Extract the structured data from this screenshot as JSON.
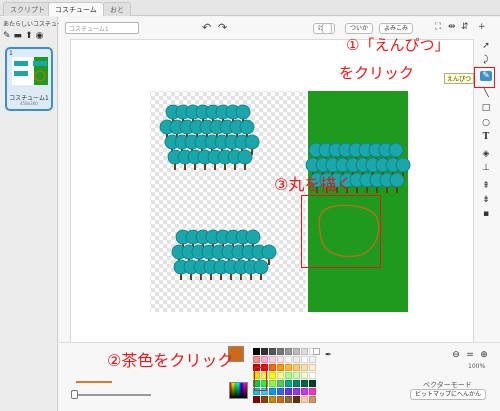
{
  "tabs": [
    {
      "label": "スクリプト"
    },
    {
      "label": "コスチューム"
    },
    {
      "label": "おと"
    }
  ],
  "costume_pane": {
    "new_label": "あたらしいコスチューム:",
    "new_icons": [
      "brush-icon",
      "library-icon",
      "upload-icon",
      "camera-icon"
    ],
    "costumes": [
      {
        "number": "1",
        "name": "コスチューム1",
        "size": "458x360"
      }
    ]
  },
  "editor": {
    "costume_name": "コスチューム1",
    "buttons": {
      "clear": "けす",
      "add": "ついか",
      "import": "よみこみ"
    },
    "tools": [
      "select-icon",
      "reshape-icon",
      "pencil-icon",
      "line-icon",
      "rectangle-icon",
      "ellipse-icon",
      "text-icon",
      "fill-icon",
      "stamp-icon",
      "forward-layer-icon",
      "back-layer-icon",
      "group-icon"
    ],
    "selected_tool": "pencil-icon",
    "tooltip": "えんぴつ",
    "zoom": "100%",
    "mode": "ベクターモード",
    "convert_button": "ビットマップにへんかん"
  },
  "palette": {
    "selected_color": "#cb6a17",
    "stroke_color": "#d97a2b",
    "columns": [
      [
        "#000000",
        "#ff8888",
        "#cc0000",
        "#ffdd00",
        "#00cc44",
        "#00ccdd",
        "#880000"
      ],
      [
        "#333333",
        "#ffaacc",
        "#ff0000",
        "#ffee55",
        "#33ee33",
        "#33ccff",
        "#884400"
      ],
      [
        "#555555",
        "#ffcce6",
        "#ff6600",
        "#ffff00",
        "#88ff44",
        "#0099ff",
        "#cc8800"
      ],
      [
        "#777777",
        "#ffe0ee",
        "#ff9900",
        "#ffff88",
        "#55cc55",
        "#3366ff",
        "#cc6a17"
      ],
      [
        "#999999",
        "#ffffff",
        "#ffbb33",
        "#aaff88",
        "#00aa88",
        "#6633ff",
        "#996633"
      ],
      [
        "#bbbbbb",
        "#eeeeee",
        "#ffcc66",
        "#ccffaa",
        "#008866",
        "#9933ff",
        "#663300"
      ],
      [
        "#dddddd",
        "#ffffff",
        "#ffe0aa",
        "#eeffcc",
        "#006644",
        "#cc33ff",
        "#ffccaa"
      ],
      [
        "#ffffff",
        "#f4f4f4",
        "#ffeecc",
        "#ffffff",
        "#004422",
        "#ff33cc",
        "#cc9966"
      ]
    ]
  },
  "annotations": {
    "step1_line1": "①「えんぴつ」",
    "step1_line2": "をクリック",
    "step2": "②茶色をクリック",
    "step3": "③丸を描く"
  },
  "colors": {
    "annotation_red": "#e41a1a",
    "selection_blue": "#3b90c9",
    "tree_teal": "#1aa7ab",
    "background_green": "#1f9a1f",
    "drawn_circle": "#cb6a17"
  }
}
